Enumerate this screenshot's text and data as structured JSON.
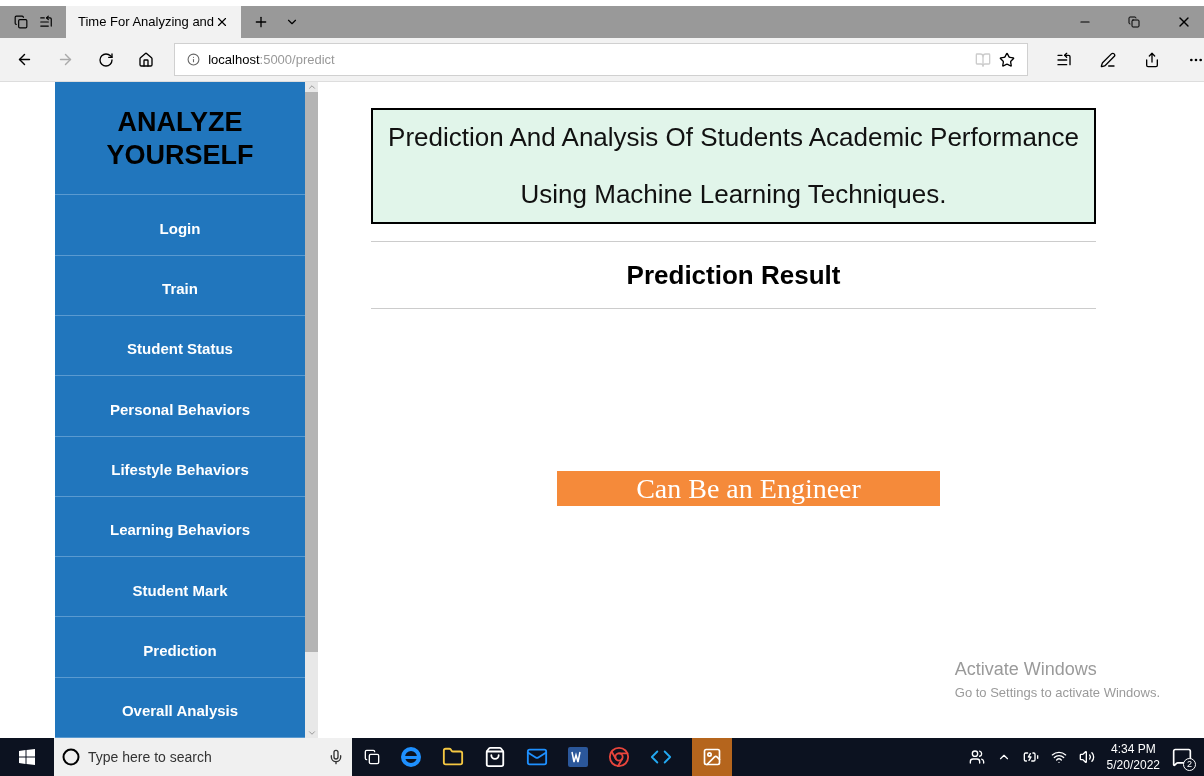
{
  "browser": {
    "tab": {
      "title": "Time For Analyzing and",
      "selected": true
    },
    "address": {
      "host": "localhost",
      "path": ":5000/predict"
    }
  },
  "sidebar": {
    "title": "ANALYZE YOURSELF",
    "items": [
      {
        "label": "Login"
      },
      {
        "label": "Train"
      },
      {
        "label": "Student Status"
      },
      {
        "label": "Personal Behaviors"
      },
      {
        "label": "Lifestyle Behaviors"
      },
      {
        "label": "Learning Behaviors"
      },
      {
        "label": "Student Mark"
      },
      {
        "label": "Prediction"
      },
      {
        "label": "Overall Analysis"
      }
    ]
  },
  "banner": {
    "lines": [
      "Prediction And Analysis Of Students Academic Performance",
      "Using Machine Learning Techniques."
    ]
  },
  "heading": "Prediction Result",
  "result": "Can Be an Engineer",
  "activation": {
    "title": "Activate Windows",
    "subtitle": "Go to Settings to activate Windows."
  },
  "taskbar": {
    "search_placeholder": "Type here to search",
    "time": "4:34 PM",
    "date": "5/20/2022",
    "notifications": "2"
  }
}
